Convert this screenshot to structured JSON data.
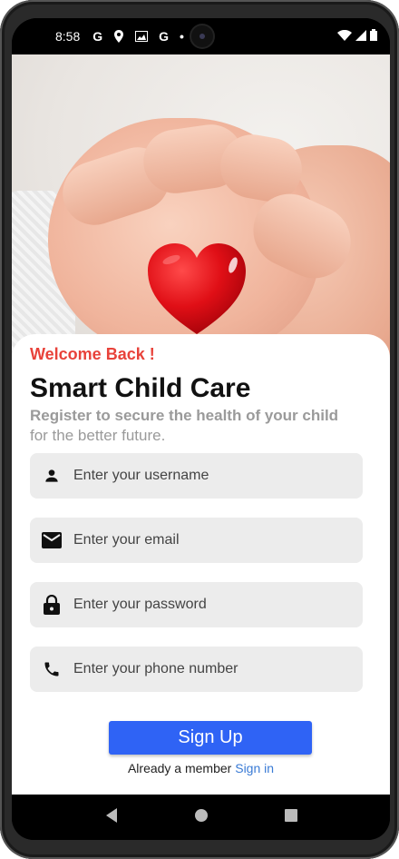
{
  "status_bar": {
    "time": "8:58",
    "icons": [
      "google-icon",
      "location-icon",
      "gallery-icon",
      "google-icon",
      "dot-icon"
    ],
    "right_icons": [
      "wifi-icon",
      "signal-icon",
      "battery-icon"
    ]
  },
  "hero": {
    "image": "baby-hand-holding-red-heart"
  },
  "card": {
    "welcome": "Welcome Back !",
    "title": "Smart Child Care",
    "subtitle_bold": "Register to secure the health of your child",
    "subtitle_rest": "for the better future."
  },
  "form": {
    "username_placeholder": "Enter your username",
    "email_placeholder": "Enter your email",
    "password_placeholder": "Enter your password",
    "phone_placeholder": "Enter your phone number",
    "signup_label": "Sign Up"
  },
  "footer": {
    "member_text": "Already a member",
    "signin_label": "Sign in"
  },
  "colors": {
    "accent_red": "#e8423a",
    "primary_blue": "#2f63f5",
    "link_blue": "#3a7bd5",
    "field_bg": "#ececec"
  }
}
